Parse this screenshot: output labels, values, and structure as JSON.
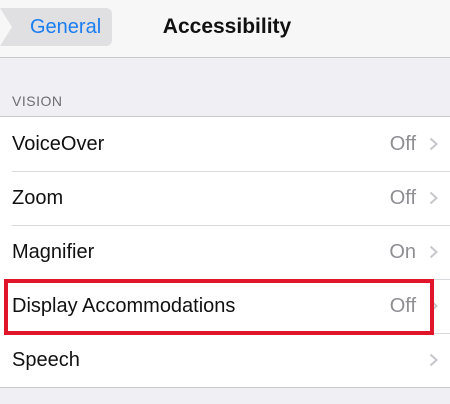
{
  "navbar": {
    "back_label": "General",
    "title": "Accessibility"
  },
  "section": {
    "header": "VISION"
  },
  "rows": [
    {
      "label": "VoiceOver",
      "value": "Off",
      "icon": "chevron-right-icon"
    },
    {
      "label": "Zoom",
      "value": "Off",
      "icon": "chevron-right-icon"
    },
    {
      "label": "Magnifier",
      "value": "On",
      "icon": "chevron-right-icon"
    },
    {
      "label": "Display Accommodations",
      "value": "Off",
      "icon": "chevron-right-icon"
    },
    {
      "label": "Speech",
      "value": "",
      "icon": "chevron-right-icon"
    }
  ],
  "colors": {
    "accent": "#1a7df0",
    "highlight": "#e0152a",
    "background": "#efeff4"
  }
}
